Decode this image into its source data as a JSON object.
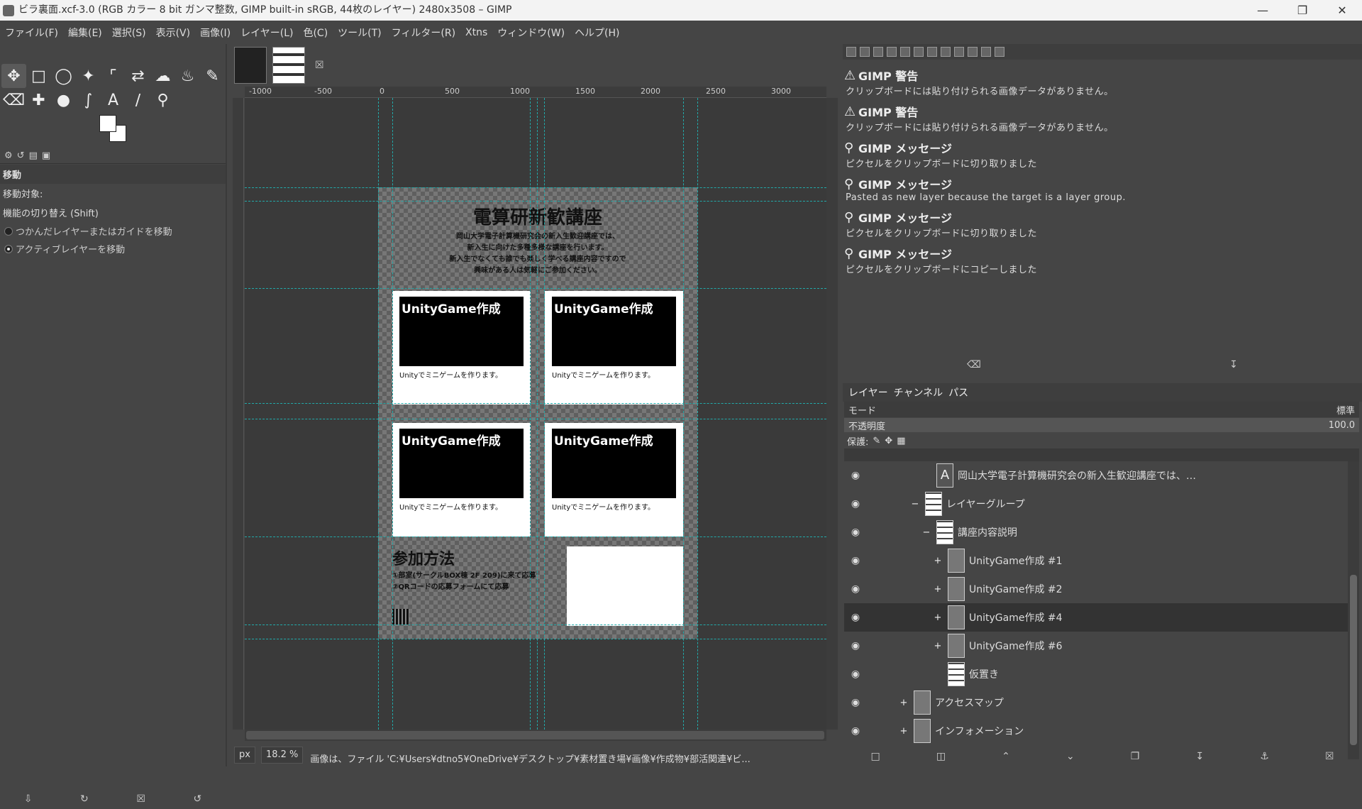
{
  "window": {
    "title": "ビラ裏面.xcf-3.0 (RGB カラー 8 bit ガンマ整数, GIMP built-in sRGB, 44枚のレイヤー) 2480x3508 – GIMP"
  },
  "menu": [
    "ファイル(F)",
    "編集(E)",
    "選択(S)",
    "表示(V)",
    "画像(I)",
    "レイヤー(L)",
    "色(C)",
    "ツール(T)",
    "フィルター(R)",
    "Xtns",
    "ウィンドウ(W)",
    "ヘルプ(H)"
  ],
  "tool_options": {
    "title": "移動",
    "target_label": "移動対象:",
    "toggle_label": "機能の切り替え (Shift)",
    "option_pick": "つかんだレイヤーまたはガイドを移動",
    "option_active": "アクティブレイヤーを移動"
  },
  "ruler": {
    "ticks": [
      "-1000",
      "-500",
      "0",
      "500",
      "1000",
      "1500",
      "2000",
      "2500",
      "3000"
    ]
  },
  "document": {
    "title": "電算研新歓講座",
    "intro": [
      "岡山大学電子計算機研究会の新入生歓迎講座では、",
      "新入生に向けた多種多様な講座を行います。",
      "新入生でなくても誰でも楽しく学べる講座内容ですので",
      "興味がある人は気軽にご参加ください。"
    ],
    "cards": [
      {
        "heading": "UnityGame作成",
        "desc": "Unityでミニゲームを作ります。"
      },
      {
        "heading": "UnityGame作成",
        "desc": "Unityでミニゲームを作ります。"
      },
      {
        "heading": "UnityGame作成",
        "desc": "Unityでミニゲームを作ります。"
      },
      {
        "heading": "UnityGame作成",
        "desc": "Unityでミニゲームを作ります。"
      }
    ],
    "join_heading": "参加方法",
    "join_lines": [
      "①部室(サークルBOX棟 2F 209)に来て応募",
      "②QRコードの応募フォームにて応募"
    ]
  },
  "status": {
    "unit": "px",
    "zoom": "18.2 %",
    "message": "画像は、ファイル 'C:¥Users¥dtno5¥OneDrive¥デスクトップ¥素材置き場¥画像¥作成物¥部活関連¥ビ..."
  },
  "error_console": [
    {
      "type": "warning",
      "heading": "GIMP 警告",
      "body": "クリップボードには貼り付けられる画像データがありません。"
    },
    {
      "type": "warning",
      "heading": "GIMP 警告",
      "body": "クリップボードには貼り付けられる画像データがありません。"
    },
    {
      "type": "info",
      "heading": "GIMP メッセージ",
      "body": "ピクセルをクリップボードに切り取りました"
    },
    {
      "type": "info",
      "heading": "GIMP メッセージ",
      "body": "Pasted as new layer because the target is a layer group."
    },
    {
      "type": "info",
      "heading": "GIMP メッセージ",
      "body": "ピクセルをクリップボードに切り取りました"
    },
    {
      "type": "info",
      "heading": "GIMP メッセージ",
      "body": "ピクセルをクリップボードにコピーしました"
    }
  ],
  "layers_panel": {
    "tabs": [
      "レイヤー",
      "チャンネル",
      "パス"
    ],
    "mode_label": "モード",
    "mode_value": "標準",
    "opacity_label": "不透明度",
    "opacity_value": "100.0",
    "lock_label": "保護:",
    "layers": [
      {
        "name": "岡山大学電子計算機研究会の新入生歓迎講座では、…",
        "kind": "text"
      },
      {
        "name": "レイヤーグループ",
        "kind": "group",
        "expander": "−"
      },
      {
        "name": "講座内容説明",
        "kind": "group",
        "expander": "−"
      },
      {
        "name": "UnityGame作成 #1",
        "kind": "group",
        "expander": "+"
      },
      {
        "name": "UnityGame作成 #2",
        "kind": "group",
        "expander": "+"
      },
      {
        "name": "UnityGame作成 #4",
        "kind": "group",
        "expander": "+",
        "selected": true
      },
      {
        "name": "UnityGame作成 #6",
        "kind": "group",
        "expander": "+"
      },
      {
        "name": "仮置き",
        "kind": "layer"
      },
      {
        "name": "アクセスマップ",
        "kind": "group",
        "expander": "+"
      },
      {
        "name": "インフォメーション",
        "kind": "group",
        "expander": "+"
      }
    ]
  },
  "colors": {
    "guide": "#22aaaa",
    "panel": "#454545",
    "selection": "#333333"
  }
}
